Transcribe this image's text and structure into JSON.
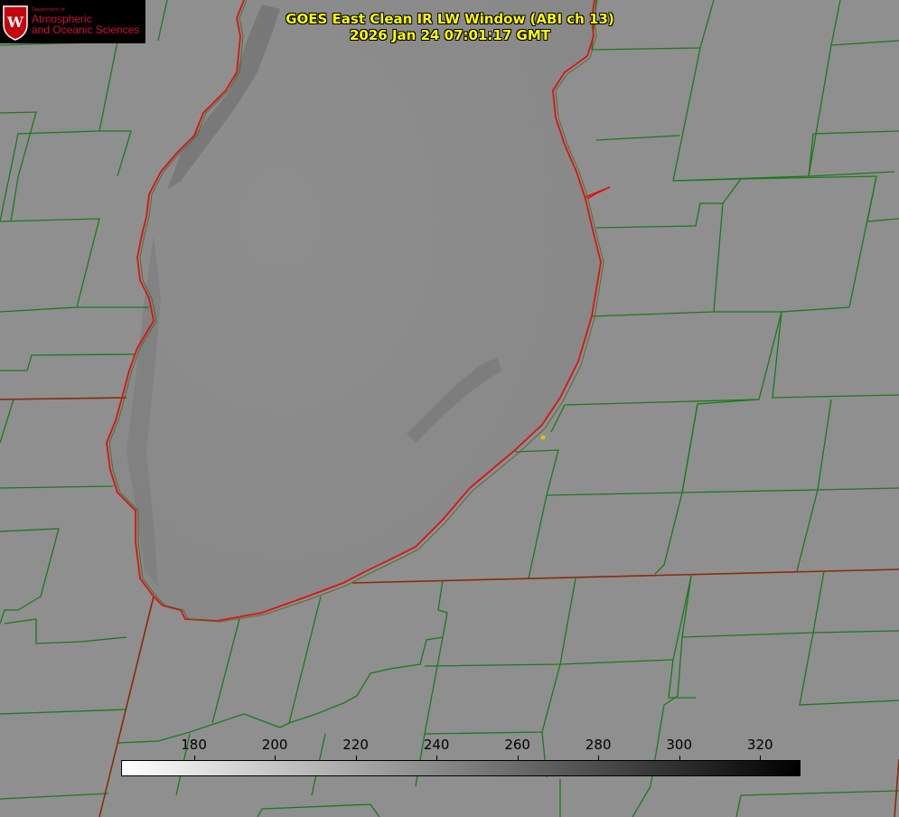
{
  "logo": {
    "department_line": "Department of",
    "name_line1": "Atmospheric",
    "name_line2": "and Oceanic Sciences"
  },
  "title": {
    "line1": "GOES East Clean IR LW Window (ABI ch 13)",
    "line2": "2026 Jan 24 07:01:17 GMT"
  },
  "colorbar": {
    "ticks": [
      "180",
      "200",
      "220",
      "240",
      "260",
      "280",
      "300",
      "320"
    ],
    "range": [
      162,
      330
    ],
    "colors": [
      "#ffffff",
      "#000000"
    ]
  },
  "colors": {
    "land": "#8c8c8c",
    "lake": "#8a8a8a",
    "lake_dark": "#6e6e6e",
    "county_lines": "#1a7a1a",
    "state_lines": "#c0200a",
    "coastline": "#e01010",
    "marker": "#e0c000"
  }
}
